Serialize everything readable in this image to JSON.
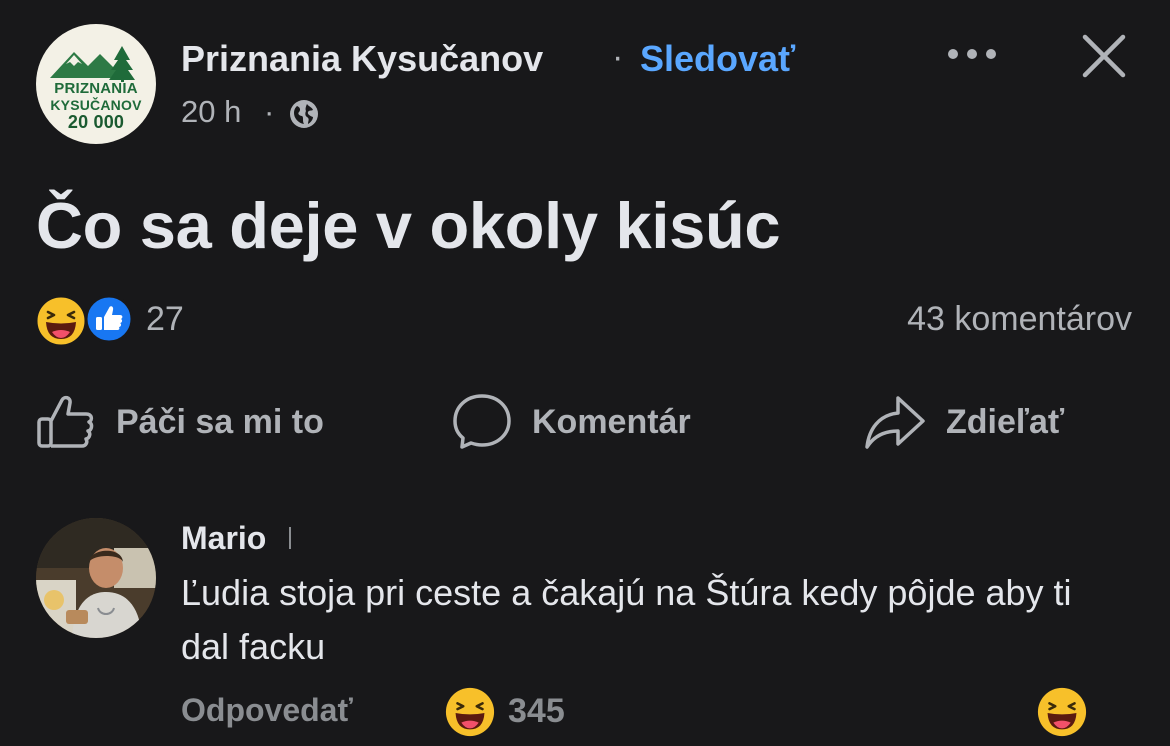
{
  "header": {
    "page_name": "Priznania Kysučanov",
    "separator": "·",
    "follow_label": "Sledovať",
    "time": "20 h",
    "time_separator": "·",
    "privacy_icon": "globe-icon",
    "more_icon": "more-icon",
    "close_icon": "close-icon",
    "logo": {
      "line1": "PRIZNANIA",
      "line2": "KYSUČANOV",
      "line3": "20 000"
    }
  },
  "post": {
    "text": "Čo sa deje v okoly kisúc"
  },
  "reactions": {
    "icons": [
      "haha-icon",
      "like-icon"
    ],
    "count": "27",
    "comments_count": "43 komentárov"
  },
  "actions": {
    "like_label": "Páči sa mi to",
    "comment_label": "Komentár",
    "share_label": "Zdieľať"
  },
  "comment": {
    "author": "Mario",
    "text": "Ľudia stoja pri ceste a čakajú na Štúra kedy pôjde aby ti dal facku",
    "reply_label": "Odpovedať",
    "reaction_icon": "haha-icon",
    "reaction_count": "345"
  },
  "colors": {
    "background": "#18181a",
    "accent": "#5aa7ff",
    "primary_text": "#e4e6eb",
    "secondary_text": "#b0b3b8",
    "like_blue": "#1877f2",
    "haha_yellow": "#f7c02a"
  }
}
